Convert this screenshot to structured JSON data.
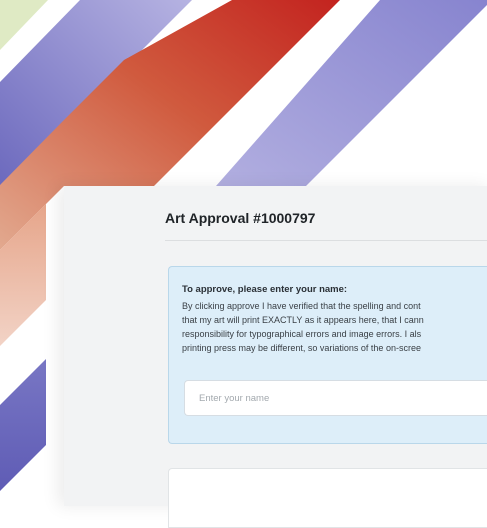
{
  "page": {
    "title": "Art Approval #1000797"
  },
  "approval": {
    "heading": "To approve, please enter your name:",
    "body_lines": [
      "By clicking approve I have verified that the spelling and cont",
      "that my art will print EXACTLY as it appears here, that I cann",
      "responsibility for typographical errors and image errors. I als",
      "printing press may be different, so variations of the on-scree"
    ],
    "name_input": {
      "value": "",
      "placeholder": "Enter your name"
    }
  },
  "colors": {
    "purple": "#6e6cc0",
    "red": "#c32a24",
    "green": "#dfeac4",
    "panel": "#f2f3f4",
    "info_box": "#ddeef9"
  }
}
